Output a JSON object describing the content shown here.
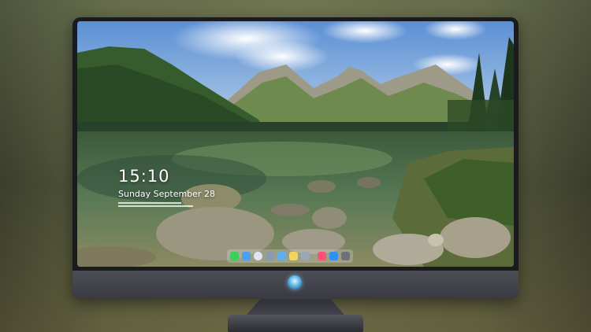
{
  "lock_screen": {
    "time": "15:10",
    "date": "Sunday September 28"
  },
  "dock": {
    "apps": [
      {
        "icon": "messages-icon",
        "color": "#3ecf5a"
      },
      {
        "icon": "finder-icon",
        "color": "#4f9ff0"
      },
      {
        "icon": "safari-icon",
        "color": "#dfe6ef"
      },
      {
        "icon": "launchpad-icon",
        "color": "#8a9bb0"
      },
      {
        "icon": "photos-icon",
        "color": "#5fb0e8"
      },
      {
        "icon": "notes-icon",
        "color": "#f6d35a"
      },
      {
        "icon": "preview-icon",
        "color": "#9aa7b6"
      },
      {
        "icon": "music-icon",
        "color": "#ff4f7a"
      },
      {
        "icon": "app-store-icon",
        "color": "#2f8ff2"
      },
      {
        "icon": "camera-icon",
        "color": "#6d7178"
      }
    ]
  },
  "colors": {
    "sky": "#6f9fd6",
    "water": "#486b52",
    "forest": "#2e4d2a"
  }
}
